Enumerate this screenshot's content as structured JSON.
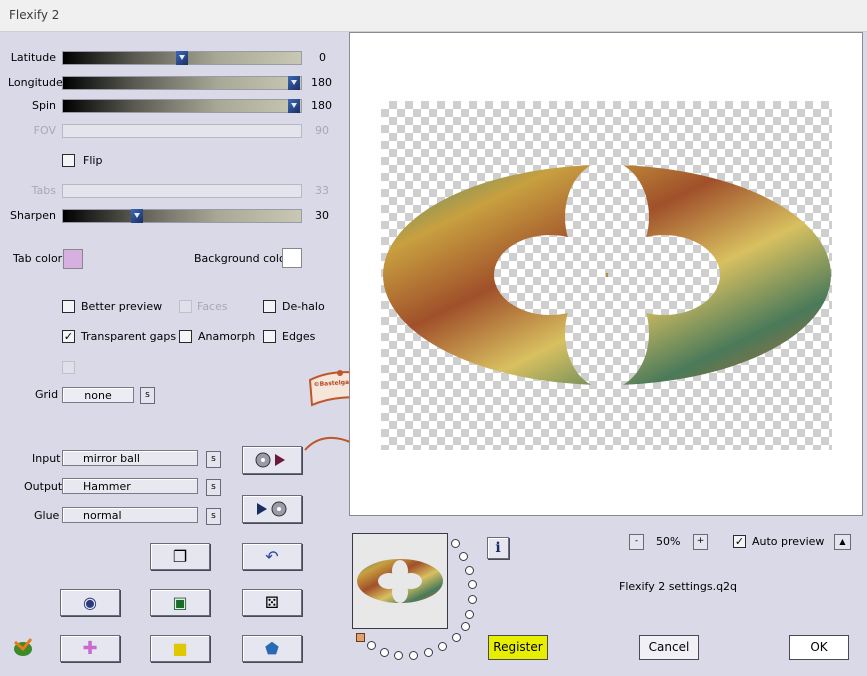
{
  "window": {
    "title": "Flexify 2"
  },
  "params": {
    "latitude": {
      "label": "Latitude",
      "value": "0",
      "position": 0.5
    },
    "longitude": {
      "label": "Longitude",
      "value": "180",
      "position": 1.0
    },
    "spin": {
      "label": "Spin",
      "value": "180",
      "position": 1.0
    },
    "fov": {
      "label": "FOV",
      "value": "90",
      "disabled": true
    },
    "tabs": {
      "label": "Tabs",
      "value": "33",
      "disabled": true
    },
    "sharpen": {
      "label": "Sharpen",
      "value": "30",
      "position": 0.3
    }
  },
  "flip": {
    "label": "Flip",
    "checked": false
  },
  "colors": {
    "tab_color_label": "Tab color",
    "tab_color": "#d6b0e0",
    "background_color_label": "Background color",
    "background_color": "#ffffff"
  },
  "options": {
    "better_preview": {
      "label": "Better preview",
      "checked": false
    },
    "faces": {
      "label": "Faces",
      "checked": false,
      "disabled": true
    },
    "de_halo": {
      "label": "De-halo",
      "checked": false
    },
    "transparent_gaps": {
      "label": "Transparent gaps",
      "checked": true
    },
    "anamorph": {
      "label": "Anamorph",
      "checked": false
    },
    "edges": {
      "label": "Edges",
      "checked": false
    }
  },
  "grid": {
    "label": "Grid",
    "value": "none",
    "s": "s"
  },
  "projection": {
    "input": {
      "label": "Input",
      "value": "mirror ball",
      "s": "s"
    },
    "output": {
      "label": "Output",
      "value": "Hammer",
      "s": "s"
    },
    "glue": {
      "label": "Glue",
      "value": "normal",
      "s": "s"
    }
  },
  "zoom": {
    "minus": "-",
    "value": "50%",
    "plus": "+"
  },
  "auto_preview": {
    "label": "Auto preview",
    "checked": true,
    "arrow": "▲"
  },
  "settings_file": "Flexify 2 settings.q2q",
  "info_glyph": "i",
  "buttons": {
    "register": "Register",
    "cancel": "Cancel",
    "ok": "OK"
  },
  "watermark": {
    "text": "©Bastelgarten Vion"
  },
  "icons": {
    "new": "❐",
    "undo": "↶",
    "ring": "◉",
    "square": "▣",
    "dice": "⚄",
    "cross": "✚",
    "box": "■",
    "gem": "⬟",
    "to_output": "▶",
    "to_input": "▶"
  },
  "colors_ui": {
    "register_bg": "#e8ee00",
    "accent_blue": "#1a2e64"
  }
}
